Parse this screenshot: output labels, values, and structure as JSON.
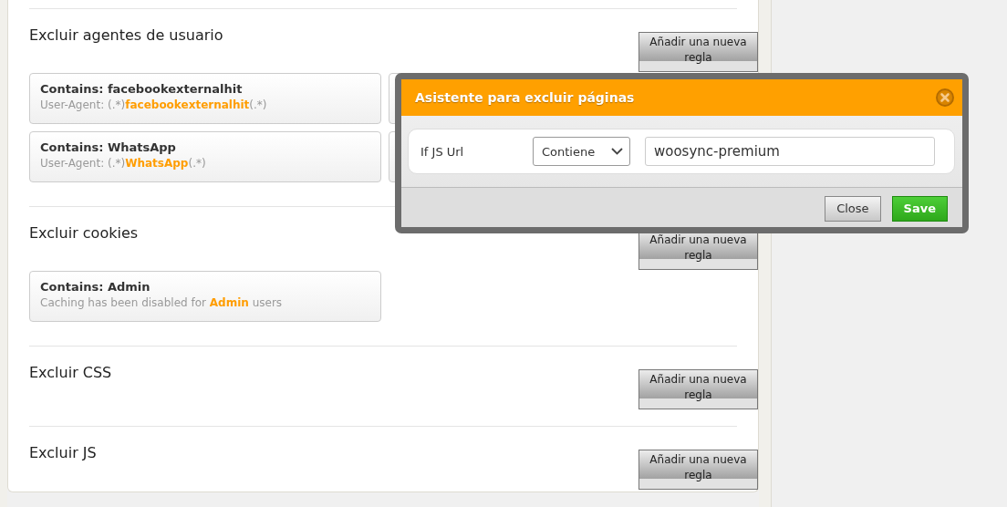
{
  "sections": [
    {
      "title": "Excluir agentes de usuario",
      "button": "Añadir una nueva regla",
      "cards": [
        {
          "kind": "rule",
          "title": "Contains: facebookexternalhit",
          "detail": "User-Agent: (.*)**facebookexternalhit**(.*)"
        },
        {
          "kind": "covered"
        },
        {
          "kind": "rule",
          "title": "Contains: WhatsApp",
          "detail": "User-Agent: (.*)**WhatsApp**(.*)"
        },
        {
          "kind": "covered"
        }
      ]
    },
    {
      "title": "Excluir cookies",
      "button": "Añadir una nueva regla",
      "cards": [
        {
          "kind": "rule",
          "title": "Contains: Admin",
          "detail": "Caching has been disabled for **Admin** users"
        }
      ]
    },
    {
      "title": "Excluir CSS",
      "button": "Añadir una nueva regla"
    },
    {
      "title": "Excluir JS",
      "button": "Añadir una nueva regla"
    }
  ],
  "dialog": {
    "title": "Asistente para excluir páginas",
    "rule": {
      "label": "If JS Url",
      "operator": "Contiene",
      "value": "woosync-premium"
    },
    "buttons": [
      {
        "label": "Close",
        "kind": "secondary"
      },
      {
        "label": "Save",
        "kind": "primary"
      }
    ]
  }
}
